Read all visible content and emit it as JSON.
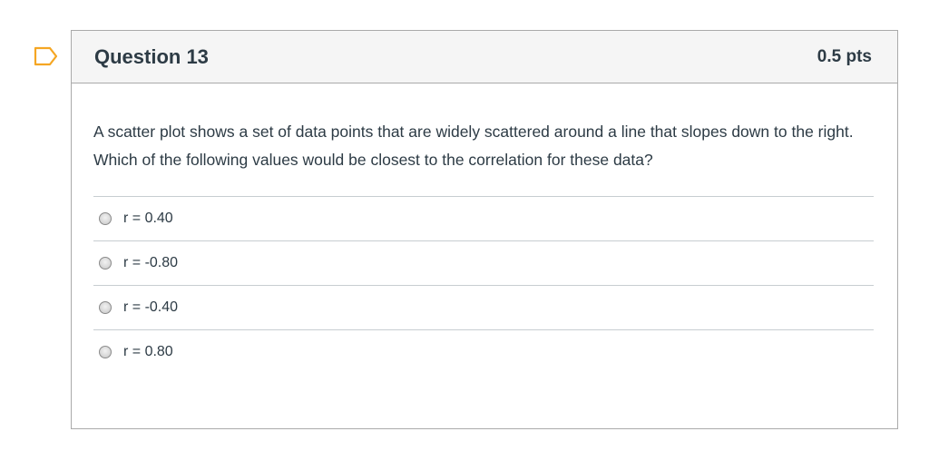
{
  "question": {
    "title": "Question 13",
    "points": "0.5 pts",
    "text": "A scatter plot shows a set of data points that are widely scattered around a line that slopes down to the right. Which of the following values would be closest to the correlation for these data?",
    "answers": [
      {
        "label": "r = 0.40"
      },
      {
        "label": "r = -0.80"
      },
      {
        "label": "r = -0.40"
      },
      {
        "label": "r = 0.80"
      }
    ]
  },
  "icons": {
    "flag": "flag-bookmark-icon",
    "radio": "radio-unselected-icon"
  },
  "colors": {
    "text": "#2d3b45",
    "header_bg": "#f5f5f5",
    "border": "#aaaaaa",
    "flag": "#f5a623"
  }
}
